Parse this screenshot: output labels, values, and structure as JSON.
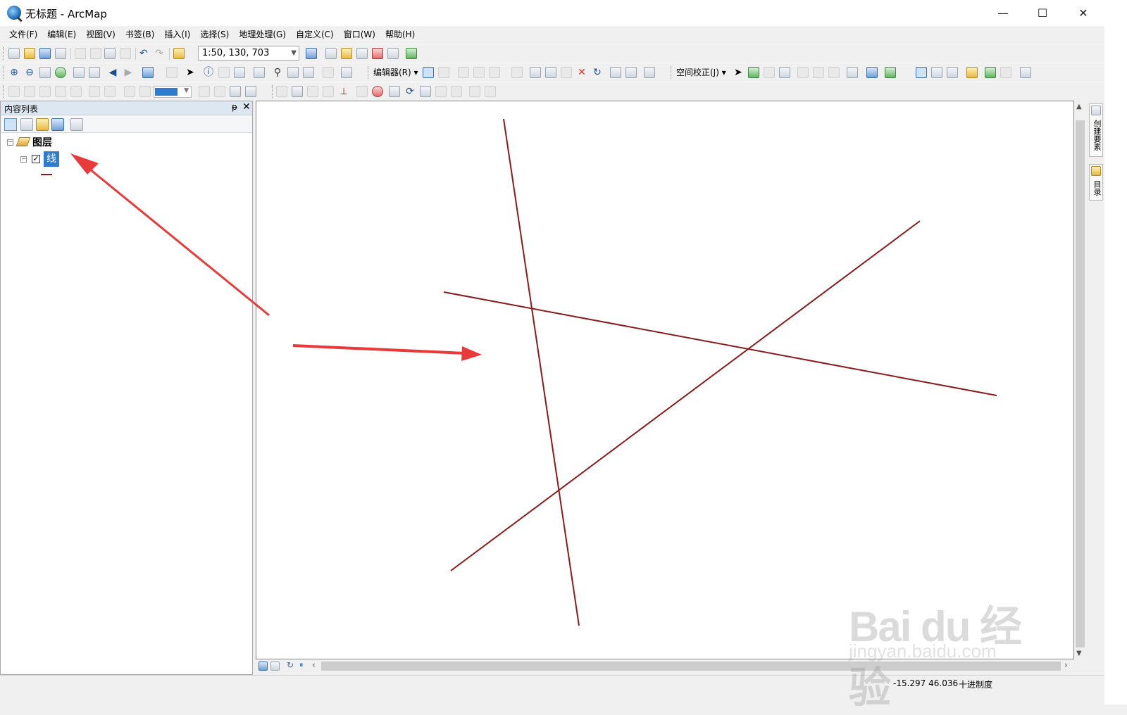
{
  "window": {
    "title": "无标题 - ArcMap",
    "minimize_glyph": "—",
    "maximize_glyph": "☐",
    "close_glyph": "✕"
  },
  "menu": [
    "文件(F)",
    "编辑(E)",
    "视图(V)",
    "书签(B)",
    "插入(I)",
    "选择(S)",
    "地理处理(G)",
    "自定义(C)",
    "窗口(W)",
    "帮助(H)"
  ],
  "toolbar": {
    "scale": "1:50, 130, 703",
    "editor_label": "编辑器(R) ▾",
    "georef_label": "空间校正(J) ▾"
  },
  "toc": {
    "title": "内容列表",
    "pin_glyph": "ᵽ",
    "close_glyph": "✕",
    "root_label": "图层",
    "expander_glyph": "−",
    "layer_name": "线",
    "layer_checked_glyph": "✓",
    "line_color": "#8b1a1a"
  },
  "map": {
    "line_color": "#8b1a1a"
  },
  "side_tabs": [
    "创建要素",
    "目录"
  ],
  "status": {
    "coords": "-15.297  46.036",
    "units": "十进制度"
  },
  "watermark": {
    "brand": "Bai du 经验",
    "url": "jingyan.baidu.com"
  },
  "annotation_color": "#e83a3a"
}
